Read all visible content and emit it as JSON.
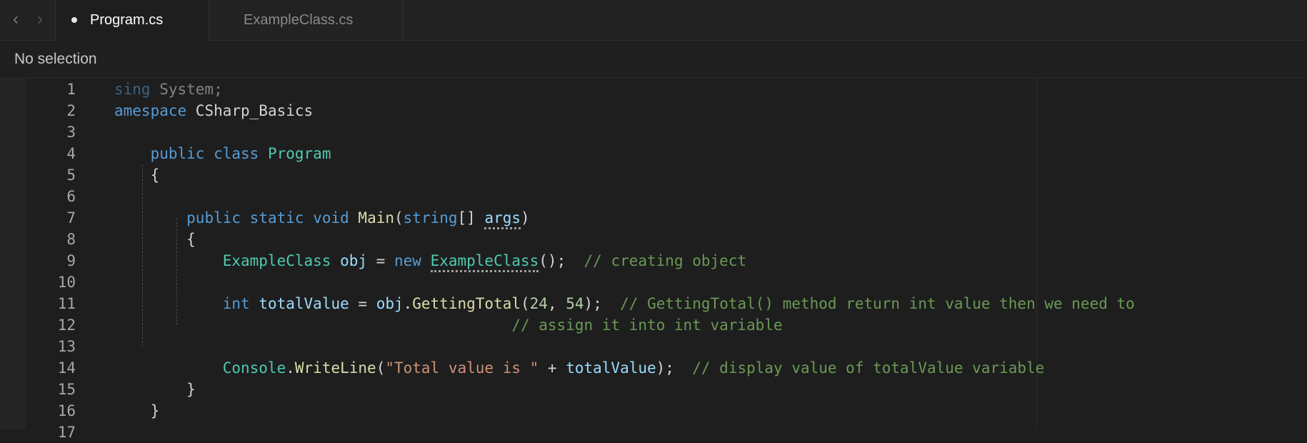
{
  "tabs": [
    {
      "label": "Program.cs",
      "active": true,
      "unsaved": true
    },
    {
      "label": "ExampleClass.cs",
      "active": false
    }
  ],
  "jump_bar": {
    "text": "No selection"
  },
  "icons": {
    "back": "chevron-left-icon",
    "forward": "chevron-right-icon",
    "unsaved": "dot-icon"
  },
  "editor": {
    "lines": [
      {
        "number": "1",
        "tokens": [
          [
            "sing",
            "kw dim"
          ],
          [
            " System;",
            "pl dim"
          ]
        ]
      },
      {
        "number": "2",
        "tokens": [
          [
            "amespace",
            "kw"
          ],
          [
            " CSharp_Basics",
            "pl"
          ]
        ]
      },
      {
        "number": "3",
        "tokens": []
      },
      {
        "number": "4",
        "tokens": [
          [
            "    "
          ],
          [
            "public",
            "kw"
          ],
          [
            " "
          ],
          [
            "class",
            "kw"
          ],
          [
            " "
          ],
          [
            "Program",
            "ty"
          ]
        ]
      },
      {
        "number": "5",
        "tokens": [
          [
            "    {",
            "pl"
          ]
        ]
      },
      {
        "number": "6",
        "tokens": []
      },
      {
        "number": "7",
        "tokens": [
          [
            "        "
          ],
          [
            "public",
            "kw"
          ],
          [
            " "
          ],
          [
            "static",
            "kw"
          ],
          [
            " "
          ],
          [
            "void",
            "kw"
          ],
          [
            " "
          ],
          [
            "Main",
            "fn"
          ],
          [
            "(",
            "pl"
          ],
          [
            "string",
            "kw"
          ],
          [
            "[] ",
            "pl"
          ],
          [
            "args",
            "vr dots"
          ],
          [
            ")",
            "pl"
          ]
        ]
      },
      {
        "number": "8",
        "tokens": [
          [
            "        {",
            "pl"
          ]
        ]
      },
      {
        "number": "9",
        "tokens": [
          [
            "            "
          ],
          [
            "ExampleClass",
            "ty"
          ],
          [
            " "
          ],
          [
            "obj",
            "vr"
          ],
          [
            " = ",
            "pl"
          ],
          [
            "new",
            "kw"
          ],
          [
            " "
          ],
          [
            "ExampleClass",
            "ty dots"
          ],
          [
            "();",
            "pl"
          ],
          [
            "  "
          ],
          [
            "// creating object",
            "cm"
          ]
        ]
      },
      {
        "number": "10",
        "tokens": []
      },
      {
        "number": "11",
        "tokens": [
          [
            "            "
          ],
          [
            "int",
            "kw"
          ],
          [
            " "
          ],
          [
            "totalValue",
            "vr"
          ],
          [
            " = ",
            "pl"
          ],
          [
            "obj",
            "vr"
          ],
          [
            ".",
            "pl"
          ],
          [
            "GettingTotal",
            "fn"
          ],
          [
            "(",
            "pl"
          ],
          [
            "24",
            "nm"
          ],
          [
            ", ",
            "pl"
          ],
          [
            "54",
            "nm"
          ],
          [
            ");",
            "pl"
          ],
          [
            "  "
          ],
          [
            "// GettingTotal() method return int value then we need to",
            "cm"
          ]
        ]
      },
      {
        "number": "12",
        "tokens": [
          [
            "                                        "
          ],
          [
            "    "
          ],
          [
            "// assign it into int variable",
            "cm"
          ]
        ]
      },
      {
        "number": "13",
        "tokens": []
      },
      {
        "number": "14",
        "tokens": [
          [
            "            "
          ],
          [
            "Console",
            "ty"
          ],
          [
            ".",
            "pl"
          ],
          [
            "WriteLine",
            "fn"
          ],
          [
            "(",
            "pl"
          ],
          [
            "\"Total value is \"",
            "st"
          ],
          [
            " + ",
            "pl"
          ],
          [
            "totalValue",
            "vr"
          ],
          [
            ");",
            "pl"
          ],
          [
            "  "
          ],
          [
            "// display value of totalValue variable",
            "cm"
          ]
        ]
      },
      {
        "number": "15",
        "tokens": [
          [
            "        }",
            "pl"
          ]
        ]
      },
      {
        "number": "16",
        "tokens": [
          [
            "    }",
            "pl"
          ]
        ]
      },
      {
        "number": "17",
        "tokens": []
      }
    ]
  }
}
